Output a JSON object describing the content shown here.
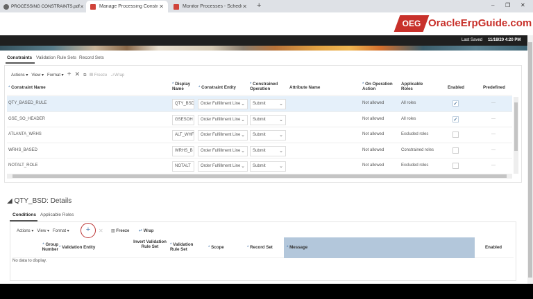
{
  "browser": {
    "tabs": [
      {
        "title": "PROCESSING CONSTRAINTS.pdf"
      },
      {
        "title": "Manage Processing Constraints"
      },
      {
        "title": "Monitor Processes - Scheduled"
      }
    ],
    "new_tab": "+",
    "minimize": "–",
    "maximize": "❐",
    "close": "✕"
  },
  "logo": {
    "badge": "OEG",
    "text": "OracleErpGuide.com"
  },
  "status": {
    "last_saved_label": "Last Saved",
    "last_saved_value": "11/18/20 4:20 PM"
  },
  "page_tabs": [
    "Constraints",
    "Validation Rule Sets",
    "Record Sets"
  ],
  "toolbar": {
    "actions": "Actions",
    "view": "View",
    "format": "Format",
    "freeze": "Freeze",
    "wrap": "Wrap"
  },
  "constraints": {
    "columns": [
      "Constraint Name",
      "Display Name",
      "Constraint Entity",
      "Constrained Operation",
      "Attribute Name",
      "On Operation Action",
      "Applicable Roles",
      "Enabled",
      "Predefined"
    ],
    "rows": [
      {
        "name": "QTY_BASED_RULE",
        "display": "QTY_BSD",
        "entity": "Order Fulfillment Line",
        "operation": "Submit",
        "attribute": "",
        "action": "Not allowed",
        "roles": "All roles",
        "enabled": true,
        "predefined": "—"
      },
      {
        "name": "GSE_SO_HEADER",
        "display": "GSESOH",
        "entity": "Order Fulfillment Line",
        "operation": "Submit",
        "attribute": "",
        "action": "Not allowed",
        "roles": "All roles",
        "enabled": true,
        "predefined": "—"
      },
      {
        "name": "ATLANTA_WRHS",
        "display": "ALT_WHF",
        "entity": "Order Fulfillment Line",
        "operation": "Submit",
        "attribute": "",
        "action": "Not allowed",
        "roles": "Excluded roles",
        "enabled": false,
        "predefined": "—"
      },
      {
        "name": "WRHS_BASED",
        "display": "WRHS_B",
        "entity": "Order Fulfillment Line",
        "operation": "Submit",
        "attribute": "",
        "action": "Not allowed",
        "roles": "Constrained roles",
        "enabled": false,
        "predefined": "—"
      },
      {
        "name": "NOTALT_ROLE",
        "display": "NOTALT",
        "entity": "Order Fulfillment Line",
        "operation": "Submit",
        "attribute": "",
        "action": "Not allowed",
        "roles": "Excluded roles",
        "enabled": false,
        "predefined": "—"
      }
    ]
  },
  "details": {
    "title": "QTY_BSD: Details",
    "tabs": [
      "Conditions",
      "Applicable Roles"
    ],
    "columns": [
      "Group Number",
      "Validation Entity",
      "Invert Validation Rule Set",
      "Validation Rule Set",
      "Scope",
      "Record Set",
      "Message",
      "Enabled"
    ],
    "empty": "No data to display."
  },
  "colors": {
    "accent": "#c8312b",
    "selected_row": "#e5f0fa",
    "message_header": "#b3c7db"
  }
}
